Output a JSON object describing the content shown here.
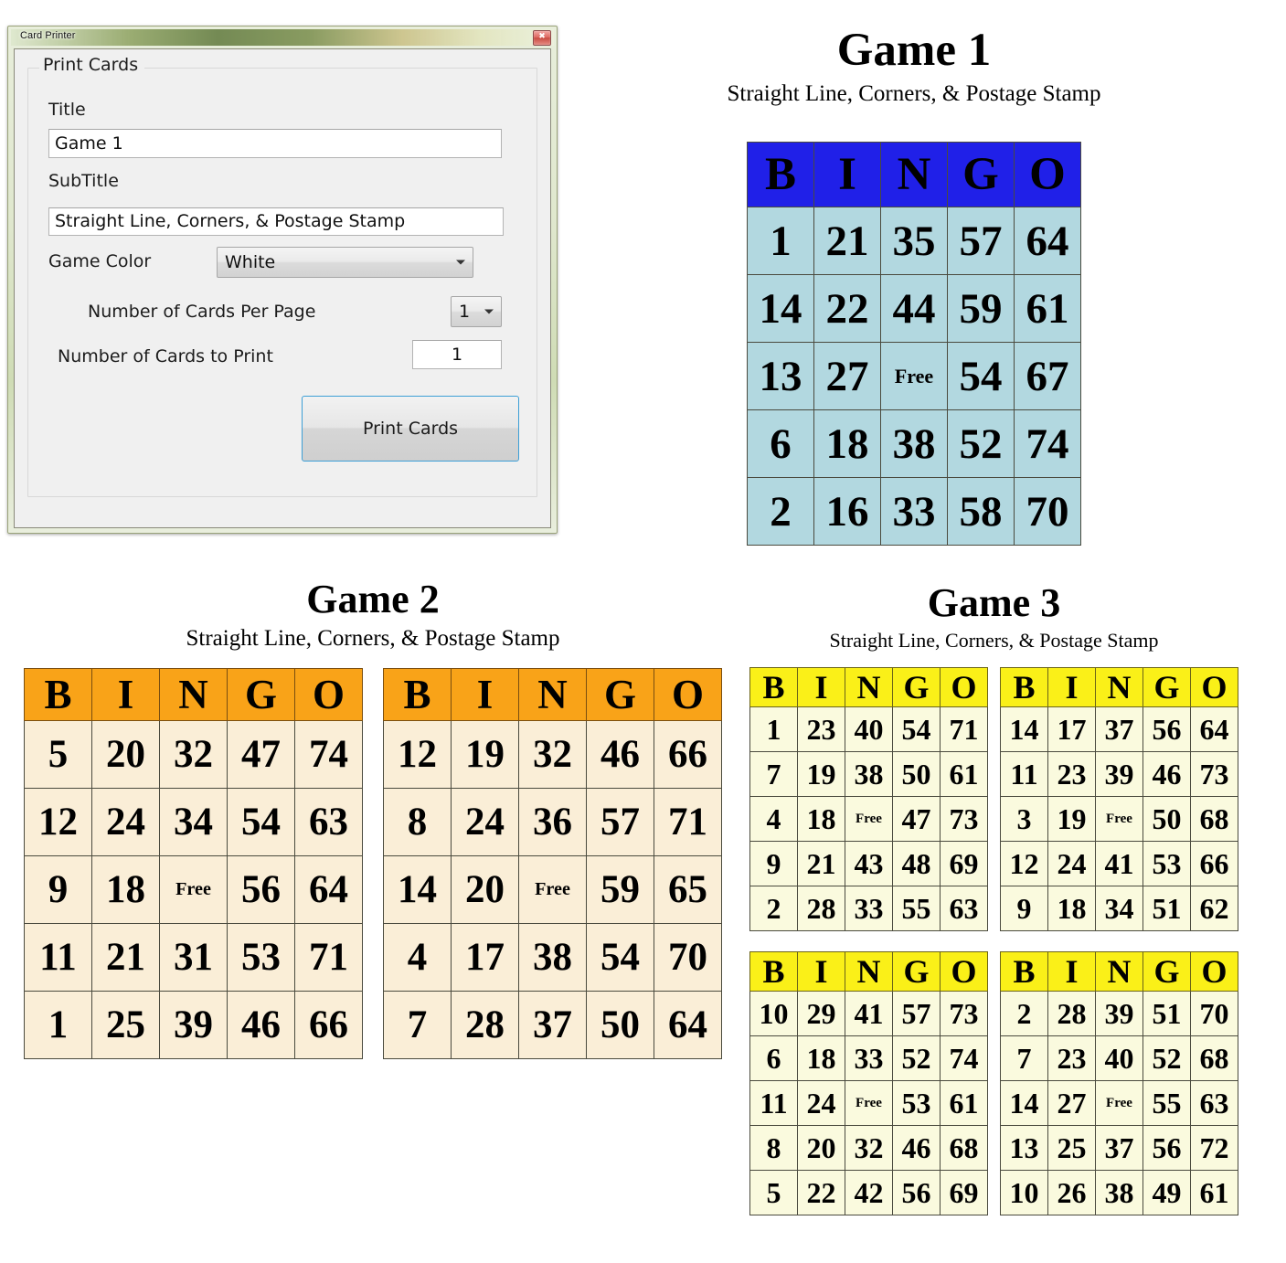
{
  "window": {
    "title": "Card Printer",
    "close_icon": "close-icon",
    "close_glyph": "✖",
    "groupbox_caption": "Print Cards",
    "fields": {
      "title_label": "Title",
      "title_value": "Game 1",
      "subtitle_label": "SubTitle",
      "subtitle_value": "Straight Line, Corners, & Postage Stamp",
      "game_color_label": "Game Color",
      "game_color_value": "White",
      "cards_per_page_label": "Number of Cards Per Page",
      "cards_per_page_value": "1",
      "cards_to_print_label": "Number of Cards to Print",
      "cards_to_print_value": "1"
    },
    "print_button_label": "Print Cards"
  },
  "colors": {
    "game1_header": "#2020e8",
    "game1_cell": "#b2d8e0",
    "game2_header": "#f9a318",
    "game2_cell": "#faeed7",
    "game3_header": "#faf018",
    "game3_cell": "#fafade",
    "accent": "#3d9fd6"
  },
  "headers": [
    "B",
    "I",
    "N",
    "G",
    "O"
  ],
  "free_label": "Free",
  "games": [
    {
      "title": "Game 1",
      "subtitle": "Straight Line, Corners, & Postage Stamp",
      "cards": [
        {
          "rows": [
            [
              "1",
              "21",
              "35",
              "57",
              "64"
            ],
            [
              "14",
              "22",
              "44",
              "59",
              "61"
            ],
            [
              "13",
              "27",
              "Free",
              "54",
              "67"
            ],
            [
              "6",
              "18",
              "38",
              "52",
              "74"
            ],
            [
              "2",
              "16",
              "33",
              "58",
              "70"
            ]
          ]
        }
      ]
    },
    {
      "title": "Game 2",
      "subtitle": "Straight Line, Corners, & Postage Stamp",
      "cards": [
        {
          "rows": [
            [
              "5",
              "20",
              "32",
              "47",
              "74"
            ],
            [
              "12",
              "24",
              "34",
              "54",
              "63"
            ],
            [
              "9",
              "18",
              "Free",
              "56",
              "64"
            ],
            [
              "11",
              "21",
              "31",
              "53",
              "71"
            ],
            [
              "1",
              "25",
              "39",
              "46",
              "66"
            ]
          ]
        },
        {
          "rows": [
            [
              "12",
              "19",
              "32",
              "46",
              "66"
            ],
            [
              "8",
              "24",
              "36",
              "57",
              "71"
            ],
            [
              "14",
              "20",
              "Free",
              "59",
              "65"
            ],
            [
              "4",
              "17",
              "38",
              "54",
              "70"
            ],
            [
              "7",
              "28",
              "37",
              "50",
              "64"
            ]
          ]
        }
      ]
    },
    {
      "title": "Game 3",
      "subtitle": "Straight Line, Corners, & Postage Stamp",
      "cards": [
        {
          "rows": [
            [
              "1",
              "23",
              "40",
              "54",
              "71"
            ],
            [
              "7",
              "19",
              "38",
              "50",
              "61"
            ],
            [
              "4",
              "18",
              "Free",
              "47",
              "73"
            ],
            [
              "9",
              "21",
              "43",
              "48",
              "69"
            ],
            [
              "2",
              "28",
              "33",
              "55",
              "63"
            ]
          ]
        },
        {
          "rows": [
            [
              "14",
              "17",
              "37",
              "56",
              "64"
            ],
            [
              "11",
              "23",
              "39",
              "46",
              "73"
            ],
            [
              "3",
              "19",
              "Free",
              "50",
              "68"
            ],
            [
              "12",
              "24",
              "41",
              "53",
              "66"
            ],
            [
              "9",
              "18",
              "34",
              "51",
              "62"
            ]
          ]
        },
        {
          "rows": [
            [
              "10",
              "29",
              "41",
              "57",
              "73"
            ],
            [
              "6",
              "18",
              "33",
              "52",
              "74"
            ],
            [
              "11",
              "24",
              "Free",
              "53",
              "61"
            ],
            [
              "8",
              "20",
              "32",
              "46",
              "68"
            ],
            [
              "5",
              "22",
              "42",
              "56",
              "69"
            ]
          ]
        },
        {
          "rows": [
            [
              "2",
              "28",
              "39",
              "51",
              "70"
            ],
            [
              "7",
              "23",
              "40",
              "52",
              "68"
            ],
            [
              "14",
              "27",
              "Free",
              "55",
              "63"
            ],
            [
              "13",
              "25",
              "37",
              "56",
              "72"
            ],
            [
              "10",
              "26",
              "38",
              "49",
              "61"
            ]
          ]
        }
      ]
    }
  ]
}
